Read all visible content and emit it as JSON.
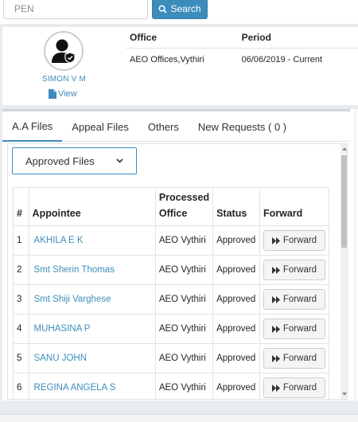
{
  "search": {
    "placeholder": "PEN",
    "button_label": "Search"
  },
  "profile": {
    "name": "SIMON V M",
    "view_label": "View",
    "posting": {
      "headers": {
        "office": "Office",
        "period": "Period"
      },
      "office": "AEO Offices,Vythiri",
      "period": "06/06/2019 - Current"
    }
  },
  "tabs": [
    {
      "label": "A.A Files",
      "active": true
    },
    {
      "label": "Appeal Files",
      "active": false
    },
    {
      "label": "Others",
      "active": false
    },
    {
      "label": "New Requests ( 0 )",
      "active": false
    }
  ],
  "filter": {
    "selected": "Approved Files"
  },
  "table": {
    "headers": {
      "num": "#",
      "appointee": "Appointee",
      "office_line1": "Processed",
      "office_line2": "Office",
      "status": "Status",
      "forward": "Forward"
    },
    "rows": [
      {
        "num": "1",
        "appointee": "AKHILA E K",
        "office": "AEO Vythiri",
        "status": "Approved",
        "forward": "Forward"
      },
      {
        "num": "2",
        "appointee": "Smt Sherin Thomas",
        "office": "AEO Vythiri",
        "status": "Approved",
        "forward": "Forward"
      },
      {
        "num": "3",
        "appointee": "Smt Shiji Varghese",
        "office": "AEO Vythiri",
        "status": "Approved",
        "forward": "Forward"
      },
      {
        "num": "4",
        "appointee": "MUHASINA P",
        "office": "AEO Vythiri",
        "status": "Approved",
        "forward": "Forward"
      },
      {
        "num": "5",
        "appointee": "SANU JOHN",
        "office": "AEO Vythiri",
        "status": "Approved",
        "forward": "Forward"
      },
      {
        "num": "6",
        "appointee": "REGINA ANGELA S",
        "office": "AEO Vythiri",
        "status": "Approved",
        "forward": "Forward"
      }
    ]
  },
  "colors": {
    "accent": "#3c8dbc",
    "link": "#3c8dbc"
  }
}
